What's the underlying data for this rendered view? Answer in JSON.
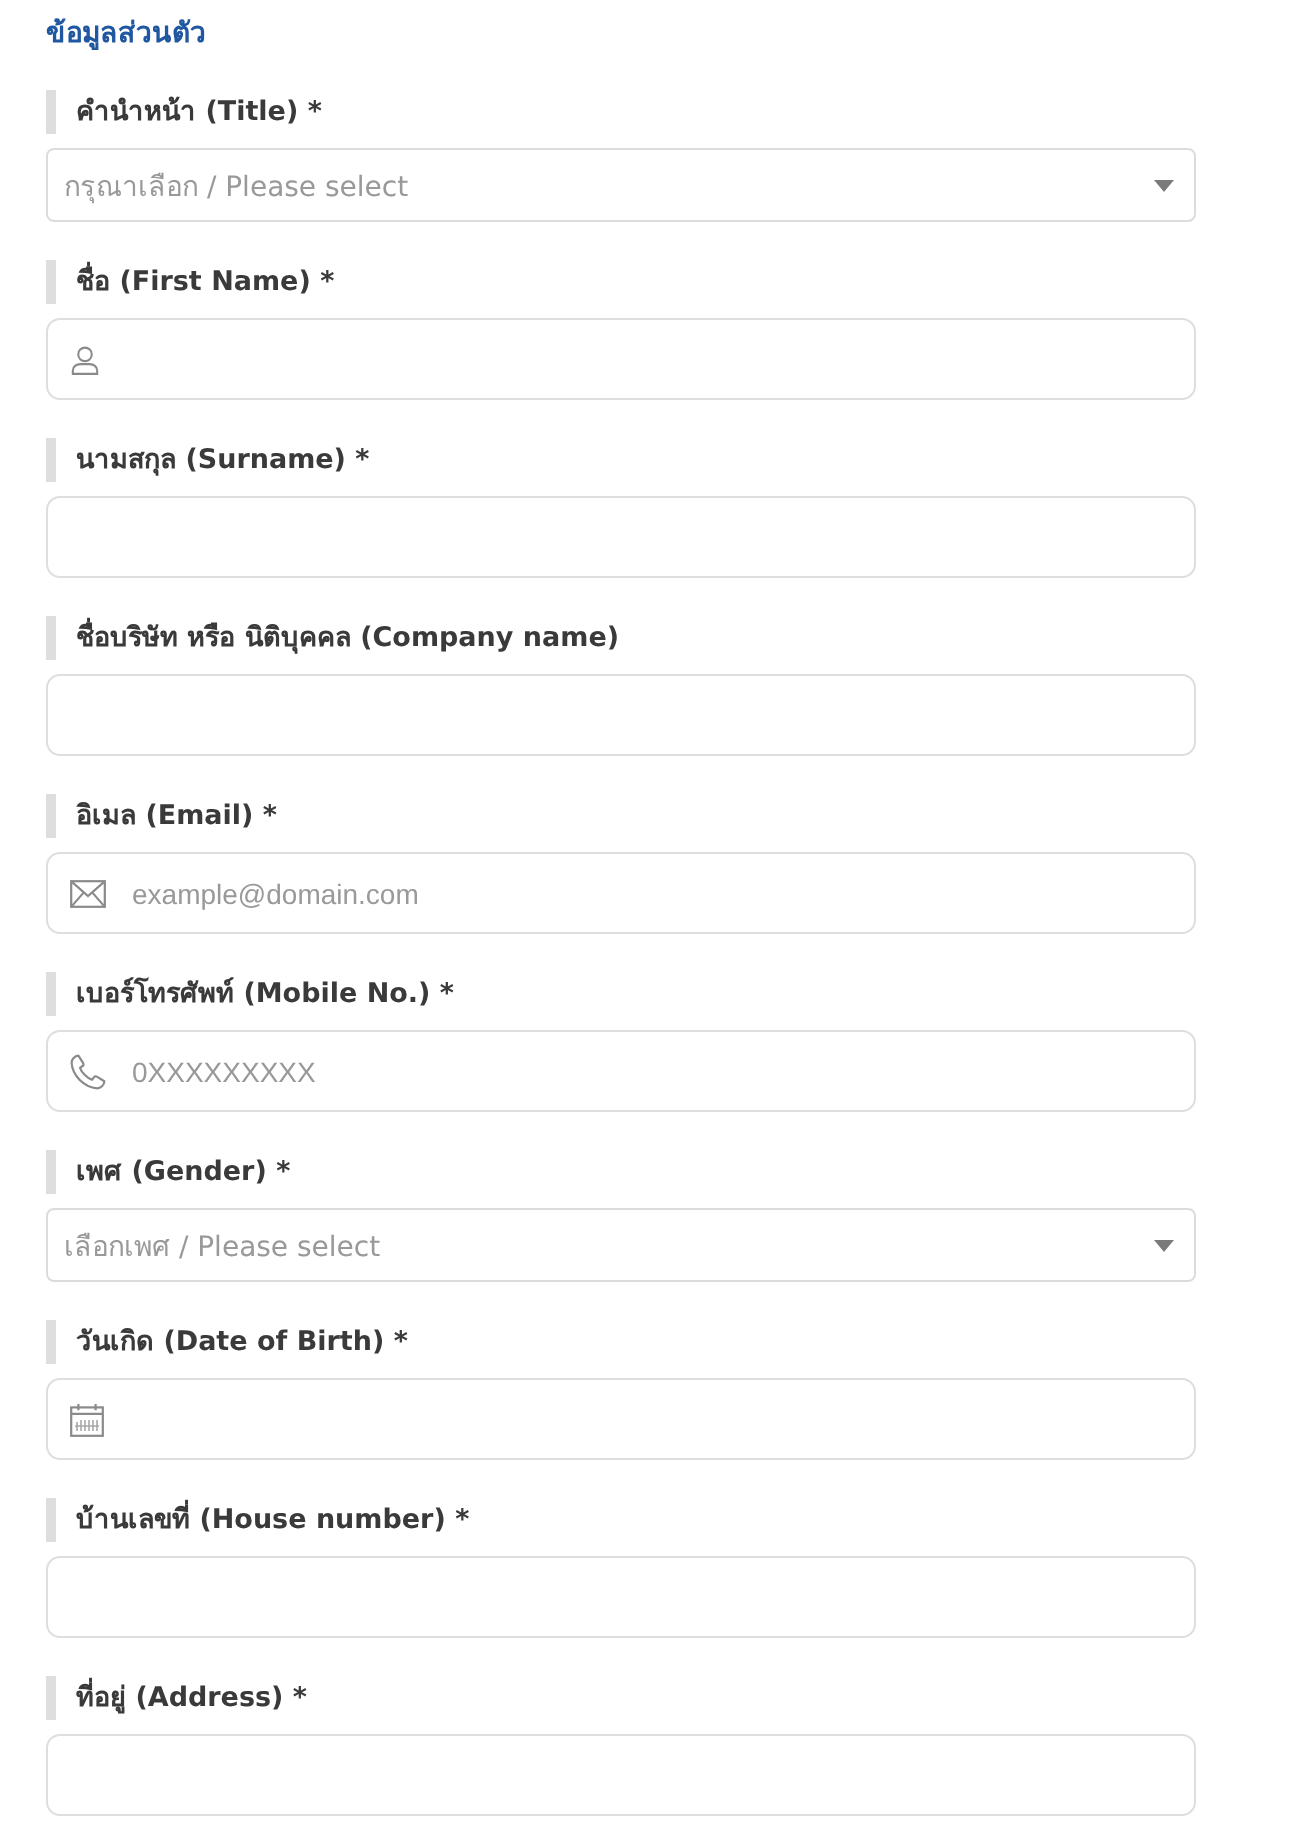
{
  "section_title": "ข้อมูลส่วนตัว",
  "fields": [
    {
      "kind": "select",
      "label": "คำนำหน้า (Title) *",
      "placeholder": "กรุณาเลือก / Please select"
    },
    {
      "kind": "name",
      "label": "ชื่อ (First Name) *"
    },
    {
      "kind": "text",
      "label": "นามสกุล (Surname) *"
    },
    {
      "kind": "text",
      "label": "ชื่อบริษัท หรือ นิติบุคคล (Company name)"
    },
    {
      "kind": "email",
      "label": "อิเมล (Email) *",
      "placeholder": "example@domain.com"
    },
    {
      "kind": "phone",
      "label": "เบอร์โทรศัพท์ (Mobile No.) *",
      "placeholder": "0XXXXXXXXX"
    },
    {
      "kind": "select",
      "label": "เพศ (Gender) *",
      "placeholder": "เลือกเพศ / Please select"
    },
    {
      "kind": "date",
      "label": "วันเกิด (Date of Birth) *"
    },
    {
      "kind": "text",
      "label": "บ้านเลขที่ (House number) *"
    },
    {
      "kind": "text",
      "label": "ที่อยู่ (Address) *"
    }
  ]
}
